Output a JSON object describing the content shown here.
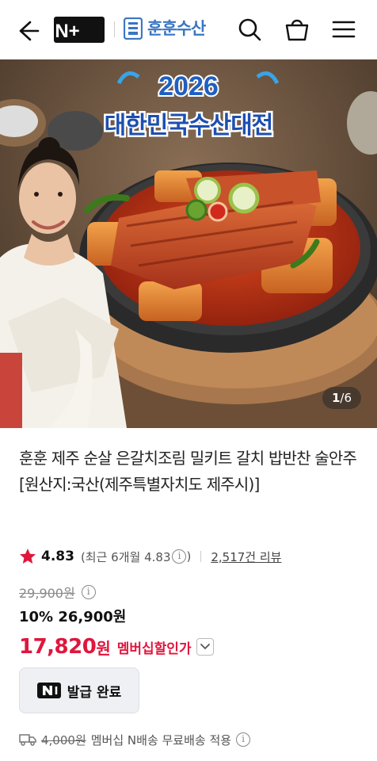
{
  "header": {
    "logo_text": "N+",
    "store_name": "훈훈수산",
    "icons": [
      "back-arrow-icon",
      "search-icon",
      "shopping-bag-icon",
      "menu-icon"
    ]
  },
  "hero": {
    "banner_year": "2026",
    "banner_title": "대한민국수산대전",
    "counter_current": "1",
    "counter_total": "/6"
  },
  "product": {
    "title": "훈훈 제주 순살 은갈치조림 밀키트 갈치 밥반찬 술안주 [원산지:국산(제주특별자치도 제주시)]",
    "rating": "4.83",
    "recent_rating": "(최근 6개월 4.83",
    "recent_close": ")",
    "review_count": "2,517건 리뷰",
    "original_price": "29,900원",
    "discount_line": "10% 26,900원",
    "member_price": "17,820",
    "member_won": "원",
    "member_label": "멤버십할인가",
    "coupon_label": "발급 완료",
    "shipping_fee": "4,000원",
    "shipping_text": "멤버십 N배송 무료배송 적용"
  },
  "colors": {
    "accent_red": "#e0163d",
    "store_blue": "#3a76c3",
    "star": "#e0163d"
  }
}
